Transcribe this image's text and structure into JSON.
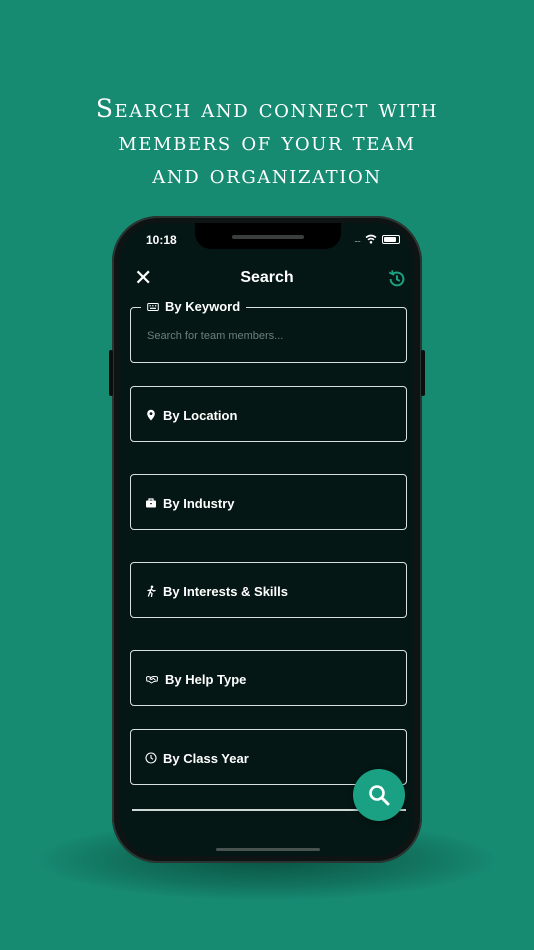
{
  "headline": {
    "line1": "Search and connect with",
    "line2": "members of your team",
    "line3": "and organization"
  },
  "status_bar": {
    "time": "10:18",
    "signal": "....",
    "icons": [
      "wifi-icon",
      "battery-icon"
    ]
  },
  "header": {
    "title": "Search",
    "close_icon": "close-icon",
    "history_icon": "history-icon"
  },
  "keyword": {
    "label": "By Keyword",
    "placeholder": "Search for team members...",
    "icon": "keyboard-icon"
  },
  "filters": [
    {
      "label": "By Location",
      "icon": "map-pin-icon"
    },
    {
      "label": "By Industry",
      "icon": "briefcase-icon"
    },
    {
      "label": "By Interests & Skills",
      "icon": "running-person-icon"
    },
    {
      "label": "By Help Type",
      "icon": "handshake-icon"
    },
    {
      "label": "By Class Year",
      "icon": "clock-icon"
    }
  ],
  "fab": {
    "icon": "search-icon"
  },
  "colors": {
    "background": "#178a72",
    "screen": "#051714",
    "accent": "#1aa184",
    "text": "#ffffff"
  }
}
